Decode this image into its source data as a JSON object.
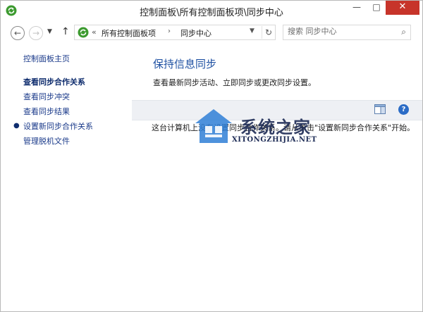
{
  "window": {
    "title": "控制面板\\所有控制面板项\\同步中心",
    "minimize_glyph": "—",
    "maximize_glyph": "□",
    "close_glyph": "✕"
  },
  "nav": {
    "back_glyph": "←",
    "forward_glyph": "→",
    "dropdown_glyph": "▼",
    "up_glyph": "↑",
    "address_prefix": "«",
    "breadcrumbs": [
      "所有控制面板项",
      "同步中心"
    ],
    "breadcrumb_sep": "›",
    "address_dropdown_glyph": "▼",
    "refresh_glyph": "↻",
    "search_placeholder": "搜索 同步中心",
    "search_glyph": "⌕"
  },
  "sidebar": {
    "items": [
      {
        "label": "控制面板主页",
        "active": false
      },
      {
        "label": "查看同步合作关系",
        "active": true
      },
      {
        "label": "查看同步冲突",
        "active": false
      },
      {
        "label": "查看同步结果",
        "active": false
      },
      {
        "label": "设置新同步合作关系",
        "active": false
      },
      {
        "label": "管理脱机文件",
        "active": false
      }
    ],
    "bullet": "●"
  },
  "main": {
    "title": "保持信息同步",
    "description": "查看最新同步活动、立即同步或更改同步设置。",
    "help_glyph": "?",
    "empty_message": "这台计算机上没有设置同步合作关系。请从单击\"设置新同步合作关系\"开始。"
  },
  "watermark": {
    "text": "系统之家",
    "subtext": "XITONGZHIJIA.NET"
  },
  "colors": {
    "accent_title": "#1e50a2",
    "link": "#1a3a8a",
    "close_button": "#c7342a",
    "sync_icon_green": "#3c9a2f"
  },
  "icons": {
    "app": "sync-center-icon",
    "view": "view-pane-icon",
    "help": "help-icon"
  }
}
